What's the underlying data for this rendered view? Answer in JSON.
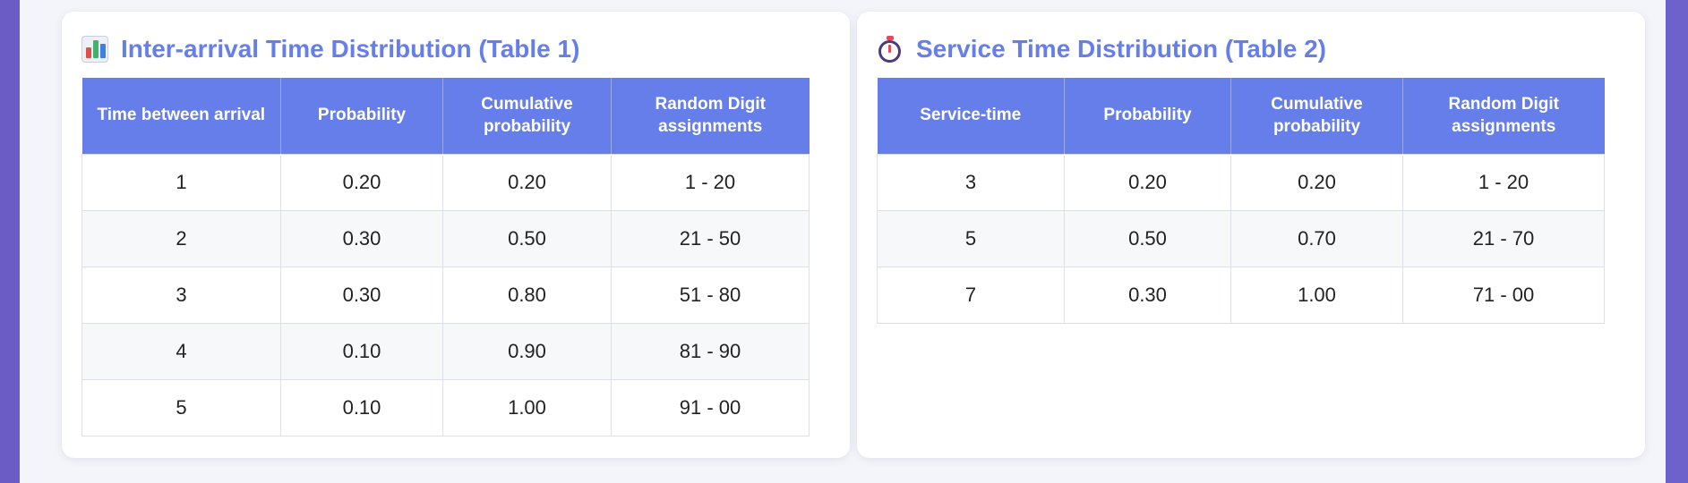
{
  "table1": {
    "title": "Inter-arrival Time Distribution (Table 1)",
    "icon": "bar-chart-icon",
    "headers": [
      "Time between arrival",
      "Probability",
      "Cumulative probability",
      "Random Digit assignments"
    ],
    "rows": [
      [
        "1",
        "0.20",
        "0.20",
        "1 - 20"
      ],
      [
        "2",
        "0.30",
        "0.50",
        "21 - 50"
      ],
      [
        "3",
        "0.30",
        "0.80",
        "51 - 80"
      ],
      [
        "4",
        "0.10",
        "0.90",
        "81 - 90"
      ],
      [
        "5",
        "0.10",
        "1.00",
        "91 - 00"
      ]
    ]
  },
  "table2": {
    "title": "Service Time Distribution (Table 2)",
    "icon": "stopwatch-icon",
    "headers": [
      "Service-time",
      "Probability",
      "Cumulative probability",
      "Random Digit assignments"
    ],
    "rows": [
      [
        "3",
        "0.20",
        "0.20",
        "1 - 20"
      ],
      [
        "5",
        "0.50",
        "0.70",
        "21 - 70"
      ],
      [
        "7",
        "0.30",
        "1.00",
        "71 - 00"
      ]
    ]
  },
  "colors": {
    "accent": "#667eea",
    "background": "#6a5cc4",
    "alt_row": "#f7f8fa"
  }
}
